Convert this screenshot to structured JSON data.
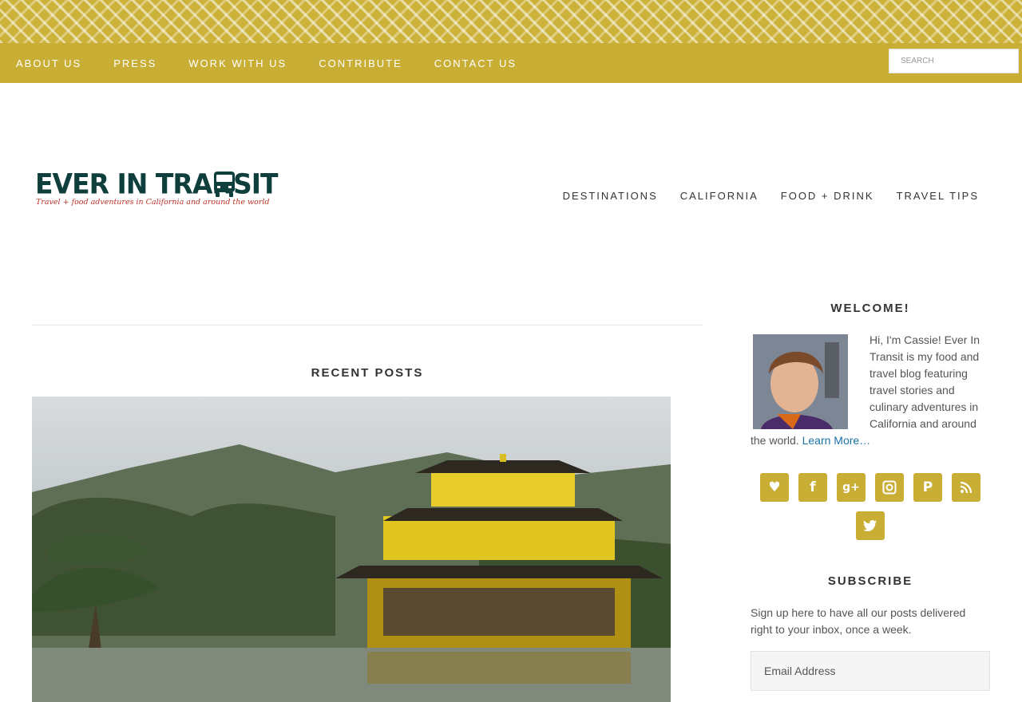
{
  "top_nav": {
    "items": [
      "ABOUT US",
      "PRESS",
      "WORK WITH US",
      "CONTRIBUTE",
      "CONTACT US"
    ],
    "search_placeholder": "SEARCH"
  },
  "logo": {
    "title": "EVER IN TRANSIT",
    "tagline": "Travel + food adventures in California and around the world"
  },
  "main_nav": {
    "items": [
      "DESTINATIONS",
      "CALIFORNIA",
      "FOOD + DRINK",
      "TRAVEL TIPS"
    ]
  },
  "content": {
    "recent_posts_title": "RECENT POSTS"
  },
  "sidebar": {
    "welcome_title": "WELCOME!",
    "welcome_text": "Hi, I'm Cassie! Ever In Transit is my food and travel blog featuring travel stories and culinary adventures in California and around the world.",
    "learn_more": "Learn More…",
    "social_icons": [
      "bloglovin-icon",
      "facebook-icon",
      "google-plus-icon",
      "instagram-icon",
      "pinterest-icon",
      "rss-icon",
      "twitter-icon"
    ],
    "subscribe_title": "SUBSCRIBE",
    "subscribe_text": "Sign up here to have all our posts delivered right to your inbox, once a week.",
    "email_placeholder": "Email Address"
  },
  "colors": {
    "accent_gold": "#c9ae36",
    "logo_green": "#0f3f3c",
    "logo_red": "#b8322a",
    "link_blue": "#1a73a8"
  }
}
